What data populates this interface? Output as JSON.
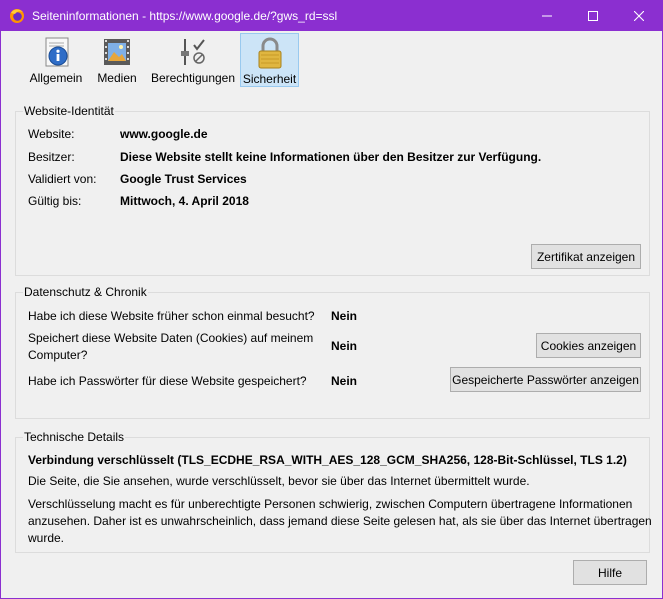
{
  "window": {
    "title": "Seiteninformationen - https://www.google.de/?gws_rd=ssl",
    "accent": "#8b2fd0"
  },
  "tabs": [
    {
      "label": "Allgemein",
      "icon": "info-icon"
    },
    {
      "label": "Medien",
      "icon": "media-icon"
    },
    {
      "label": "Berechtigungen",
      "icon": "permissions-icon"
    },
    {
      "label": "Sicherheit",
      "icon": "lock-icon",
      "selected": true
    }
  ],
  "identity": {
    "title": "Website-Identität",
    "website_label": "Website:",
    "website_value": "www.google.de",
    "owner_label": "Besitzer:",
    "owner_value": "Diese Website stellt keine Informationen über den Besitzer zur Verfügung.",
    "verified_label": "Validiert von:",
    "verified_value": "Google Trust Services",
    "valid_label": "Gültig bis:",
    "valid_value": "Mittwoch, 4. April 2018",
    "cert_button": "Zertifikat anzeigen"
  },
  "privacy": {
    "title": "Datenschutz & Chronik",
    "q1": "Habe ich diese Website früher schon einmal besucht?",
    "a1": "Nein",
    "q2_line1": "Speichert diese Website Daten (Cookies) auf meinem",
    "q2_line2": "Computer?",
    "a2": "Nein",
    "cookies_button": "Cookies anzeigen",
    "q3": "Habe ich Passwörter für diese Website gespeichert?",
    "a3": "Nein",
    "passwords_button": "Gespeicherte Passwörter anzeigen"
  },
  "technical": {
    "title": "Technische Details",
    "connection": "Verbindung verschlüsselt (TLS_ECDHE_RSA_WITH_AES_128_GCM_SHA256, 128-Bit-Schlüssel, TLS 1.2)",
    "line1": "Die Seite, die Sie ansehen, wurde verschlüsselt, bevor sie über das Internet übermittelt wurde.",
    "para_line1": "Verschlüsselung macht es für unberechtigte Personen schwierig, zwischen Computern übertragene Informationen",
    "para_line2": "anzusehen. Daher ist es unwahrscheinlich, dass jemand diese Seite gelesen hat, als sie über das Internet übertragen",
    "para_line3": "wurde."
  },
  "footer": {
    "help_button": "Hilfe"
  }
}
